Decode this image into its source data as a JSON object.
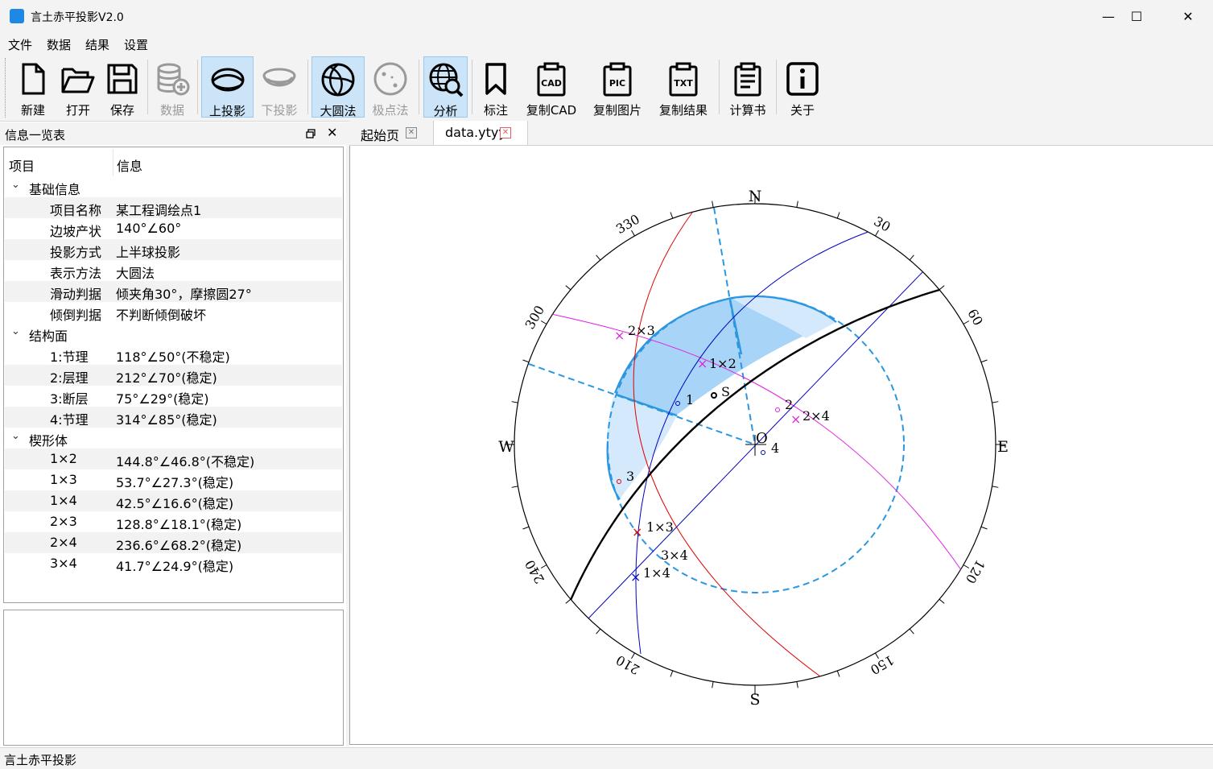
{
  "window": {
    "title": "言土赤平投影V2.0"
  },
  "menu": [
    "文件",
    "数据",
    "结果",
    "设置"
  ],
  "toolbar": {
    "new": "新建",
    "open": "打开",
    "save": "保存",
    "data": "数据",
    "upper": "上投影",
    "lower": "下投影",
    "great_circle": "大圆法",
    "pole": "极点法",
    "analyze": "分析",
    "annotate": "标注",
    "copy_cad": "复制CAD",
    "copy_pic": "复制图片",
    "copy_result": "复制结果",
    "calc_book": "计算书",
    "about": "关于",
    "cad_text": "CAD",
    "pic_text": "PIC",
    "txt_text": "TXT"
  },
  "panel": {
    "title": "信息一览表",
    "col_item": "项目",
    "col_info": "信息"
  },
  "groups": {
    "basic": "基础信息",
    "planes": "结构面",
    "wedges": "楔形体"
  },
  "basic": [
    {
      "k": "项目名称",
      "v": "某工程调绘点1"
    },
    {
      "k": "边坡产状",
      "v": "140°∠60°"
    },
    {
      "k": "投影方式",
      "v": "上半球投影"
    },
    {
      "k": "表示方法",
      "v": "大圆法"
    },
    {
      "k": "滑动判据",
      "v": "倾夹角30°，摩擦圆27°"
    },
    {
      "k": "倾倒判据",
      "v": "不判断倾倒破坏"
    }
  ],
  "planes": [
    {
      "k": "1:节理",
      "v": "118°∠50°(不稳定)"
    },
    {
      "k": "2:层理",
      "v": "212°∠70°(稳定)"
    },
    {
      "k": "3:断层",
      "v": "75°∠29°(稳定)"
    },
    {
      "k": "4:节理",
      "v": "314°∠85°(稳定)"
    }
  ],
  "wedges": [
    {
      "k": "1×2",
      "v": "144.8°∠46.8°(不稳定)"
    },
    {
      "k": "1×3",
      "v": "53.7°∠27.3°(稳定)"
    },
    {
      "k": "1×4",
      "v": "42.5°∠16.6°(稳定)"
    },
    {
      "k": "2×3",
      "v": "128.8°∠18.1°(稳定)"
    },
    {
      "k": "2×4",
      "v": "236.6°∠68.2°(稳定)"
    },
    {
      "k": "3×4",
      "v": "41.7°∠24.9°(稳定)"
    }
  ],
  "tabs": [
    {
      "label": "起始页"
    },
    {
      "label": "data.ytyy"
    }
  ],
  "stereonet": {
    "north": "N",
    "south": "S",
    "east": "E",
    "west": "W",
    "deg_330": "330",
    "deg_30": "30",
    "deg_60": "60",
    "deg_300": "300",
    "deg_120": "120",
    "deg_240": "240",
    "deg_150": "150",
    "deg_210": "210",
    "center": "O",
    "slope_label": "S",
    "p1": "1",
    "p2": "2",
    "p3": "3",
    "p4": "4",
    "i12": "1×2",
    "i13": "1×3",
    "i14": "1×4",
    "i23": "2×3",
    "i24": "2×4",
    "i34": "3×4"
  },
  "status": "言土赤平投影"
}
